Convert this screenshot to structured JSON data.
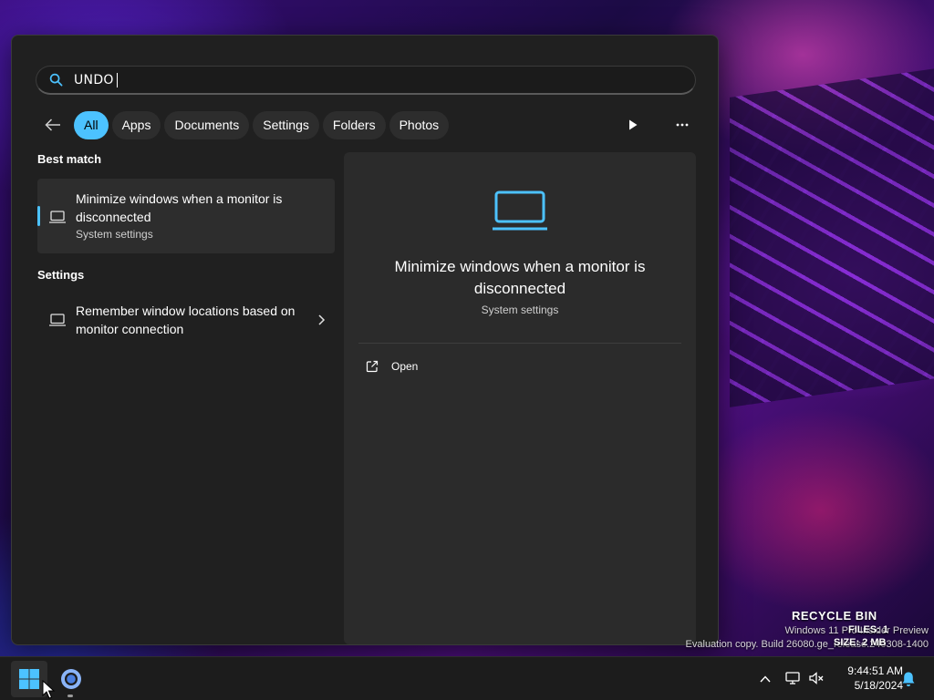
{
  "search": {
    "query": "UNDO",
    "icon": "search-icon"
  },
  "filters": {
    "back_icon": "arrow-left-icon",
    "chips": [
      "All",
      "Apps",
      "Documents",
      "Settings",
      "Folders",
      "Photos"
    ],
    "active": "All",
    "play_icon": "play-icon",
    "more_icon": "more-horizontal-icon"
  },
  "results": {
    "best_match_heading": "Best match",
    "best_match": {
      "title": "Minimize windows when a monitor is disconnected",
      "subtitle": "System settings",
      "icon": "laptop-icon"
    },
    "settings_heading": "Settings",
    "settings_items": [
      {
        "title": "Remember window locations based on monitor connection",
        "icon": "laptop-icon"
      }
    ]
  },
  "detail": {
    "icon": "laptop-icon",
    "title": "Minimize windows when a monitor is disconnected",
    "subtitle": "System settings",
    "actions": [
      {
        "label": "Open",
        "icon": "open-external-icon"
      }
    ]
  },
  "desktop": {
    "recycle_label": "RECYCLE BIN",
    "files_label": "FILES: 1",
    "size_label": "SIZE: 2 MB",
    "watermark_line1": "Windows 11 Pro Insider Preview",
    "watermark_line2": "Evaluation copy. Build 26080.ge_release.240308-1400"
  },
  "taskbar": {
    "start_icon": "windows-logo-icon",
    "pinned_app_icon": "chrome-icon",
    "tray_chevron_icon": "chevron-up-icon",
    "time": "9:44:51 AM",
    "date": "5/18/2024",
    "notification_icon": "bell-icon"
  },
  "colors": {
    "accent": "#4cc2ff",
    "panel_bg": "#202020",
    "pane_bg": "#2b2b2b",
    "chip_bg": "#2d2d2d",
    "taskbar_bg": "#1c1c1c"
  }
}
